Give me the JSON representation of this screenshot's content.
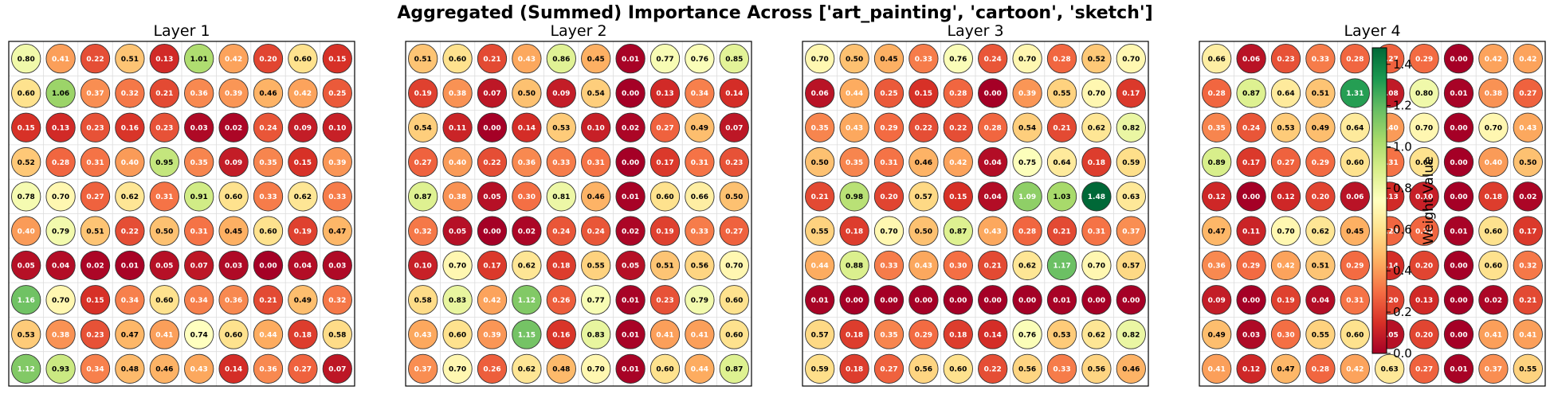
{
  "title": "Aggregated (Summed) Importance Across ['art_painting', 'cartoon', 'sketch']",
  "colorbar": {
    "label": "Weight Value",
    "min": 0.0,
    "max": 1.48,
    "colormap": "RdYlGn",
    "ticks": [
      "0.0",
      "0.2",
      "0.4",
      "0.6",
      "0.8",
      "1.0",
      "1.2",
      "1.4"
    ]
  },
  "colors": {
    "red": "#a50026",
    "yellow": "#ffffbf",
    "green": "#006837",
    "grid": "#dddddd",
    "frame": "#000000"
  },
  "chart_data": [
    {
      "type": "heatmap",
      "title": "Layer 1",
      "rows": 10,
      "cols": 10,
      "values": [
        [
          0.8,
          0.41,
          0.22,
          0.51,
          0.13,
          1.01,
          0.42,
          0.2,
          0.6,
          0.15
        ],
        [
          0.6,
          1.06,
          0.37,
          0.32,
          0.21,
          0.36,
          0.39,
          0.46,
          0.42,
          0.25
        ],
        [
          0.15,
          0.13,
          0.23,
          0.16,
          0.23,
          0.03,
          0.02,
          0.24,
          0.09,
          0.1
        ],
        [
          0.52,
          0.28,
          0.31,
          0.4,
          0.95,
          0.35,
          0.09,
          0.35,
          0.15,
          0.39
        ],
        [
          0.78,
          0.7,
          0.27,
          0.62,
          0.31,
          0.91,
          0.6,
          0.33,
          0.62,
          0.33
        ],
        [
          0.4,
          0.79,
          0.51,
          0.22,
          0.5,
          0.31,
          0.45,
          0.6,
          0.19,
          0.47
        ],
        [
          0.05,
          0.04,
          0.02,
          0.01,
          0.05,
          0.07,
          0.03,
          0.0,
          0.04,
          0.03
        ],
        [
          1.16,
          0.7,
          0.15,
          0.34,
          0.6,
          0.34,
          0.36,
          0.21,
          0.49,
          0.32
        ],
        [
          0.53,
          0.38,
          0.23,
          0.47,
          0.41,
          0.74,
          0.6,
          0.44,
          0.18,
          0.58
        ],
        [
          1.12,
          0.93,
          0.34,
          0.48,
          0.46,
          0.43,
          0.14,
          0.36,
          0.27,
          0.07
        ]
      ]
    },
    {
      "type": "heatmap",
      "title": "Layer 2",
      "rows": 10,
      "cols": 10,
      "values": [
        [
          0.51,
          0.6,
          0.21,
          0.43,
          0.86,
          0.45,
          0.01,
          0.77,
          0.76,
          0.85
        ],
        [
          0.19,
          0.38,
          0.07,
          0.5,
          0.09,
          0.54,
          0.0,
          0.13,
          0.34,
          0.14
        ],
        [
          0.54,
          0.11,
          0.0,
          0.14,
          0.53,
          0.1,
          0.02,
          0.27,
          0.49,
          0.07
        ],
        [
          0.27,
          0.4,
          0.22,
          0.36,
          0.33,
          0.31,
          0.0,
          0.17,
          0.31,
          0.23
        ],
        [
          0.87,
          0.38,
          0.05,
          0.3,
          0.81,
          0.46,
          0.01,
          0.6,
          0.66,
          0.5
        ],
        [
          0.32,
          0.05,
          0.0,
          0.02,
          0.24,
          0.24,
          0.02,
          0.19,
          0.33,
          0.27
        ],
        [
          0.1,
          0.7,
          0.17,
          0.62,
          0.18,
          0.55,
          0.05,
          0.51,
          0.56,
          0.7
        ],
        [
          0.58,
          0.83,
          0.42,
          1.12,
          0.26,
          0.77,
          0.01,
          0.23,
          0.79,
          0.6
        ],
        [
          0.43,
          0.6,
          0.39,
          1.15,
          0.16,
          0.83,
          0.01,
          0.41,
          0.41,
          0.6
        ],
        [
          0.37,
          0.7,
          0.26,
          0.62,
          0.48,
          0.7,
          0.01,
          0.6,
          0.44,
          0.87
        ]
      ]
    },
    {
      "type": "heatmap",
      "title": "Layer 3",
      "rows": 10,
      "cols": 10,
      "values": [
        [
          0.7,
          0.5,
          0.45,
          0.33,
          0.76,
          0.24,
          0.7,
          0.28,
          0.52,
          0.7
        ],
        [
          0.06,
          0.44,
          0.25,
          0.15,
          0.28,
          0.0,
          0.39,
          0.55,
          0.7,
          0.17
        ],
        [
          0.35,
          0.43,
          0.29,
          0.22,
          0.22,
          0.28,
          0.54,
          0.21,
          0.62,
          0.82
        ],
        [
          0.5,
          0.35,
          0.31,
          0.46,
          0.42,
          0.04,
          0.75,
          0.64,
          0.18,
          0.59
        ],
        [
          0.21,
          0.98,
          0.2,
          0.57,
          0.15,
          0.04,
          1.09,
          1.03,
          1.48,
          0.63
        ],
        [
          0.55,
          0.18,
          0.7,
          0.5,
          0.87,
          0.43,
          0.28,
          0.21,
          0.31,
          0.37
        ],
        [
          0.44,
          0.88,
          0.33,
          0.43,
          0.3,
          0.21,
          0.62,
          1.17,
          0.7,
          0.57
        ],
        [
          0.01,
          0.0,
          0.0,
          0.0,
          0.0,
          0.0,
          0.0,
          0.01,
          0.0,
          0.0
        ],
        [
          0.57,
          0.18,
          0.35,
          0.29,
          0.18,
          0.14,
          0.76,
          0.53,
          0.62,
          0.82
        ],
        [
          0.59,
          0.18,
          0.27,
          0.56,
          0.6,
          0.22,
          0.56,
          0.33,
          0.56,
          0.46
        ]
      ]
    },
    {
      "type": "heatmap",
      "title": "Layer 4",
      "rows": 10,
      "cols": 10,
      "values": [
        [
          0.66,
          0.06,
          0.23,
          0.33,
          0.28,
          0.27,
          0.29,
          0.0,
          0.42,
          0.42
        ],
        [
          0.28,
          0.87,
          0.64,
          0.51,
          1.31,
          0.08,
          0.8,
          0.01,
          0.38,
          0.27
        ],
        [
          0.35,
          0.24,
          0.53,
          0.49,
          0.64,
          0.4,
          0.7,
          0.0,
          0.7,
          0.43
        ],
        [
          0.89,
          0.17,
          0.27,
          0.29,
          0.6,
          0.31,
          0.6,
          0.0,
          0.4,
          0.5
        ],
        [
          0.12,
          0.0,
          0.12,
          0.2,
          0.06,
          0.13,
          0.1,
          0.0,
          0.18,
          0.02
        ],
        [
          0.47,
          0.11,
          0.7,
          0.62,
          0.45,
          0.28,
          0.28,
          0.01,
          0.6,
          0.17
        ],
        [
          0.36,
          0.29,
          0.42,
          0.51,
          0.29,
          0.14,
          0.2,
          0.0,
          0.6,
          0.32
        ],
        [
          0.09,
          0.0,
          0.19,
          0.04,
          0.31,
          0.2,
          0.13,
          0.0,
          0.02,
          0.21
        ],
        [
          0.49,
          0.03,
          0.3,
          0.55,
          0.6,
          0.05,
          0.2,
          0.0,
          0.41,
          0.41
        ],
        [
          0.41,
          0.12,
          0.47,
          0.28,
          0.42,
          0.63,
          0.27,
          0.01,
          0.37,
          0.55
        ]
      ]
    }
  ]
}
